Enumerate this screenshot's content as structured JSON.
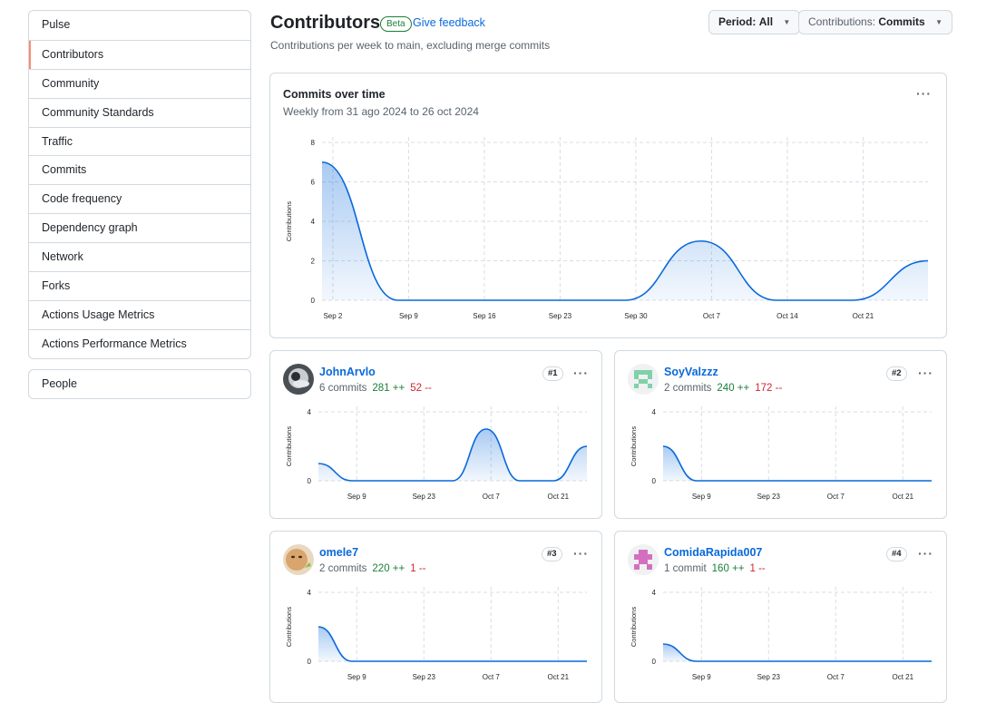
{
  "sidebar": {
    "items": [
      {
        "label": "Pulse"
      },
      {
        "label": "Contributors",
        "selected": true
      },
      {
        "label": "Community"
      },
      {
        "label": "Community Standards"
      },
      {
        "label": "Traffic"
      },
      {
        "label": "Commits"
      },
      {
        "label": "Code frequency"
      },
      {
        "label": "Dependency graph"
      },
      {
        "label": "Network"
      },
      {
        "label": "Forks"
      },
      {
        "label": "Actions Usage Metrics"
      },
      {
        "label": "Actions Performance Metrics"
      }
    ],
    "people": "People"
  },
  "header": {
    "title": "Contributors",
    "badge": "Beta",
    "feedback": "Give feedback",
    "subtitle": "Contributions per week to main, excluding merge commits",
    "period_label": "Period:",
    "period_value": "All",
    "contrib_label": "Contributions:",
    "contrib_value": "Commits"
  },
  "main_chart": {
    "title": "Commits over time",
    "subtitle": "Weekly from 31 ago 2024 to 26 oct 2024"
  },
  "chart_data": [
    {
      "type": "area",
      "title": "Commits over time",
      "ylabel": "Contributions",
      "xlabel": "",
      "ylim": [
        0,
        8
      ],
      "yticks": [
        "0",
        "2",
        "4",
        "6",
        "8"
      ],
      "xticks": [
        "Sep 2",
        "Sep 9",
        "Sep 16",
        "Sep 23",
        "Sep 30",
        "Oct 7",
        "Oct 14",
        "Oct 21"
      ],
      "x": [
        "2024-09-01",
        "2024-09-08",
        "2024-09-15",
        "2024-09-22",
        "2024-09-29",
        "2024-10-06",
        "2024-10-13",
        "2024-10-20",
        "2024-10-27"
      ],
      "values": [
        7,
        0,
        0,
        0,
        0,
        3,
        0,
        0,
        2
      ],
      "grid": true,
      "color": "#0969da"
    },
    {
      "type": "area",
      "ylabel": "Contributions",
      "ylim": [
        0,
        4
      ],
      "yticks": [
        "0",
        "4"
      ],
      "xticks": [
        "Sep 9",
        "Sep 23",
        "Oct 7",
        "Oct 21"
      ],
      "x": [
        "2024-09-01",
        "2024-09-08",
        "2024-09-15",
        "2024-09-22",
        "2024-09-29",
        "2024-10-06",
        "2024-10-13",
        "2024-10-20",
        "2024-10-27"
      ],
      "values": [
        1,
        0,
        0,
        0,
        0,
        3,
        0,
        0,
        2
      ]
    },
    {
      "type": "area",
      "ylabel": "Contributions",
      "ylim": [
        0,
        4
      ],
      "yticks": [
        "0",
        "4"
      ],
      "xticks": [
        "Sep 9",
        "Sep 23",
        "Oct 7",
        "Oct 21"
      ],
      "x": [
        "2024-09-01",
        "2024-09-08",
        "2024-09-15",
        "2024-09-22",
        "2024-09-29",
        "2024-10-06",
        "2024-10-13",
        "2024-10-20",
        "2024-10-27"
      ],
      "values": [
        2,
        0,
        0,
        0,
        0,
        0,
        0,
        0,
        0
      ]
    },
    {
      "type": "area",
      "ylabel": "Contributions",
      "ylim": [
        0,
        4
      ],
      "yticks": [
        "0",
        "4"
      ],
      "xticks": [
        "Sep 9",
        "Sep 23",
        "Oct 7",
        "Oct 21"
      ],
      "x": [
        "2024-09-01",
        "2024-09-08",
        "2024-09-15",
        "2024-09-22",
        "2024-09-29",
        "2024-10-06",
        "2024-10-13",
        "2024-10-20",
        "2024-10-27"
      ],
      "values": [
        2,
        0,
        0,
        0,
        0,
        0,
        0,
        0,
        0
      ]
    },
    {
      "type": "area",
      "ylabel": "Contributions",
      "ylim": [
        0,
        4
      ],
      "yticks": [
        "0",
        "4"
      ],
      "xticks": [
        "Sep 9",
        "Sep 23",
        "Oct 7",
        "Oct 21"
      ],
      "x": [
        "2024-09-01",
        "2024-09-08",
        "2024-09-15",
        "2024-09-22",
        "2024-09-29",
        "2024-10-06",
        "2024-10-13",
        "2024-10-20",
        "2024-10-27"
      ],
      "values": [
        1,
        0,
        0,
        0,
        0,
        0,
        0,
        0,
        0
      ]
    }
  ],
  "contributors": [
    {
      "name": "JohnArvlo",
      "commits": "6 commits",
      "additions": "281 ++",
      "deletions": "52 --",
      "rank": "#1",
      "avatar_icon": "photo-avatar-icon"
    },
    {
      "name": "SoyValzzz",
      "commits": "2 commits",
      "additions": "240 ++",
      "deletions": "172 --",
      "rank": "#2",
      "avatar_icon": "identicon-green-icon",
      "avatar_color": "#7fd1a8"
    },
    {
      "name": "omele7",
      "commits": "2 commits",
      "additions": "220 ++",
      "deletions": "1 --",
      "rank": "#3",
      "avatar_icon": "photo-avatar-icon"
    },
    {
      "name": "ComidaRapida007",
      "commits": "1 commit",
      "additions": "160 ++",
      "deletions": "1 --",
      "rank": "#4",
      "avatar_icon": "identicon-pink-icon",
      "avatar_color": "#d46fc0"
    }
  ],
  "colors": {
    "accent": "#0969da",
    "additions": "#1a7f37",
    "deletions": "#d1242f",
    "border": "#d1d9e0",
    "selected_marker": "#fd8c73"
  }
}
